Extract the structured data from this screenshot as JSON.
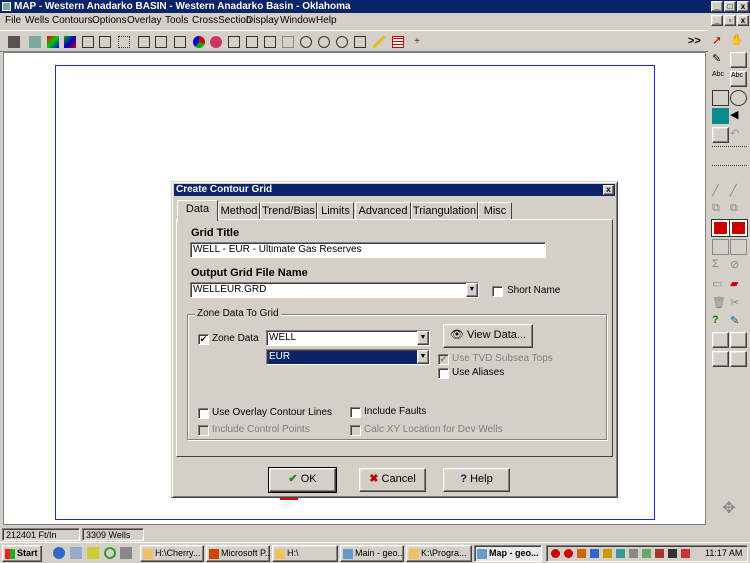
{
  "window": {
    "title": "MAP - Western Anadarko BASIN - Western Anadarko Basin - Oklahoma"
  },
  "menu": [
    "File",
    "Wells",
    "Contours",
    "Options",
    "Overlay",
    "Tools",
    "CrossSection",
    "Display",
    "Window",
    "Help"
  ],
  "toolbar": {
    "overflow_label": ">>"
  },
  "dialog": {
    "title": "Create Contour Grid",
    "close_glyph": "x",
    "tabs": [
      "Data",
      "Method",
      "Trend/Bias",
      "Limits",
      "Advanced",
      "Triangulation",
      "Misc"
    ],
    "active_tab": "Data",
    "grid_title_label": "Grid Title",
    "grid_title_value": "WELL - EUR - Ultimate Gas Reserves",
    "output_label": "Output Grid File Name",
    "output_value": "WELLEUR.GRD",
    "short_name_label": "Short Name",
    "zone_group_label": "Zone Data To Grid",
    "zone_data_label": "Zone Data",
    "zone_value": "WELL",
    "zone_field_value": "EUR",
    "view_data_label": "View Data...",
    "use_tvd_label": "Use TVD Subsea Tops",
    "use_aliases_label": "Use Aliases",
    "use_overlay_label": "Use Overlay Contour Lines",
    "include_faults_label": "Include Faults",
    "include_control_label": "Include Control Points",
    "calc_xy_label": "Calc XY Location for Dev Wells",
    "ok_label": "OK",
    "cancel_label": "Cancel",
    "help_label": "Help"
  },
  "status": {
    "left": "212401 Ft/In",
    "wells": "3309 Wells"
  },
  "taskbar": {
    "start_label": "Start",
    "tasks": [
      "H:\\Cherry...",
      "Microsoft P...",
      "H:\\",
      "Main - geo...",
      "K:\\Progra...",
      "Map - geo..."
    ],
    "clock": "11:17 AM"
  },
  "colors": {
    "titlebar": "#0a246a",
    "face": "#d4d0c8",
    "map_frame": "#1f2bc9",
    "check_green": "#1a8a1a",
    "cancel_red": "#c00000"
  }
}
